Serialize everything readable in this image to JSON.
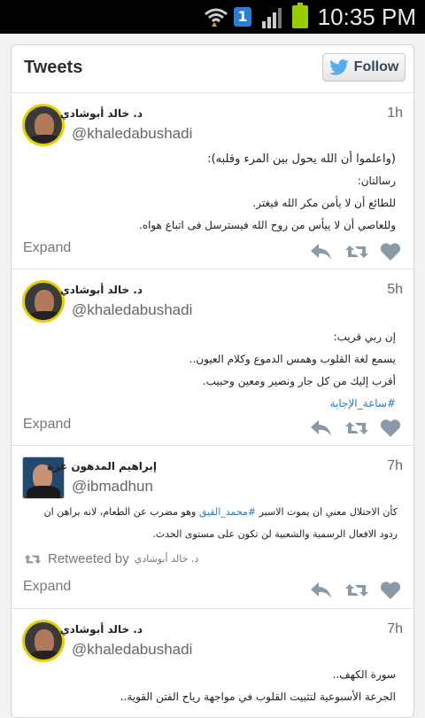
{
  "status_bar": {
    "time": "10:35 PM",
    "notification_count": "1"
  },
  "header": {
    "title": "Tweets",
    "follow_label": "Follow"
  },
  "tweets": [
    {
      "name": "د. خالد أبوشادي",
      "handle": "@khaledabushadi",
      "time": "1h",
      "lines": [
        "(واعلموا أن الله يحول بين المرء وقلبه):",
        "رسالتان:",
        "للطائع أن لا يأمن مكر الله فيغتر.",
        "وللعاصي أن لا ييأس من روح الله فيسترسل فى اتباع هواه."
      ],
      "expand": "Expand"
    },
    {
      "name": "د. خالد أبوشادي",
      "handle": "@khaledabushadi",
      "time": "5h",
      "lines": [
        "إن ربي قريب:",
        "يسمع لغة القلوب وهمس الدموع وكلام العيون..",
        "أقرب إليك من كل جار ونصير ومعين وحبيب."
      ],
      "hashtag": "#ساعة_الإجابة",
      "expand": "Expand"
    },
    {
      "name": "إبراهيم المدهون غزة",
      "handle": "@ibmadhun",
      "time": "7h",
      "line1_pre": "كأن الاحتلال معني ان يموت الاسير ",
      "line1_tag": "#محمد_القيق",
      "line1_post": " وهو مضرب عن الطعام، لانه يراهن ان",
      "line2": "ردود الافعال الرسمية والشعبية لن تكون على مستوى الحدث.",
      "retweeted_by": "Retweeted by",
      "retweeter": "د. خالد أبوشادي",
      "expand": "Expand"
    },
    {
      "name": "د. خالد أبوشادي",
      "handle": "@khaledabushadi",
      "time": "7h",
      "lines": [
        "سورة الكهف..",
        "الجرعة الأسبوعية لتثبيت القلوب في مواجهة رياح الفتن القوية.."
      ]
    }
  ],
  "colors": {
    "accent": "#2b7bb9",
    "avatar_ring": "#e6d100",
    "icon": "#8b9aa8"
  }
}
